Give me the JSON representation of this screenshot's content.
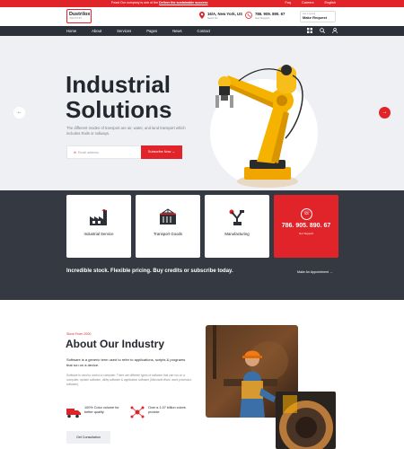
{
  "topbar": {
    "promo": "Feast Our company is one of the",
    "promo_link": "Deliver the sustainable success",
    "links": [
      "Faq",
      "Careers"
    ],
    "language": "English"
  },
  "header": {
    "logo_name": "Dustrilox",
    "logo_sub": "INDUSTRY",
    "address_line1": "16/A, New York, US",
    "address_line2": "Send Us",
    "phone_line1": "786. 909. 890. 67",
    "phone_line2": "Get Support",
    "quote_small": "Get a Quote",
    "quote_label": "Make Request"
  },
  "nav": {
    "items": [
      "Home",
      "About",
      "Services",
      "Pages",
      "News",
      "Contact"
    ]
  },
  "hero": {
    "title_line1": "Industrial",
    "title_line2": "Solutions",
    "description": "The different modes of transport are air, water, and land transport which includes Rails or railways.",
    "email_placeholder": "Email address",
    "subscribe_label": "Subscribe Now →",
    "prev_arrow": "←",
    "next_arrow": "→"
  },
  "services": {
    "cards": [
      {
        "label": "Industrial Service",
        "icon": "factory-icon"
      },
      {
        "label": "Transport Goods",
        "icon": "container-icon"
      },
      {
        "label": "Manufacturing",
        "icon": "robot-arm-icon"
      }
    ],
    "support_number": "786. 905. 890. 67",
    "support_caption": "Get Support",
    "tagline": "Incredible stock. Flexible pricing. Buy credits or subscribe today.",
    "appointment_label": "Make An Appointment →"
  },
  "about": {
    "since": "Since From 2000",
    "title": "About Our Industry",
    "lead": "Software is a generic term used to refer to applications, scripts & programs that run on a device.",
    "text": "Software is used to control a computer. There are different types of software that can run on a computer: system software, utility software & application software (Microsoft Word, word processor, software).",
    "feature1": "100% Color volume for better quality",
    "feature2": "Over a 1.07 billion colors provide",
    "consult_label": "Get Consultation"
  },
  "colors": {
    "accent": "#e0242a",
    "dark": "#353a42",
    "nav": "#2c3038",
    "hero_bg": "#eef0f3"
  }
}
